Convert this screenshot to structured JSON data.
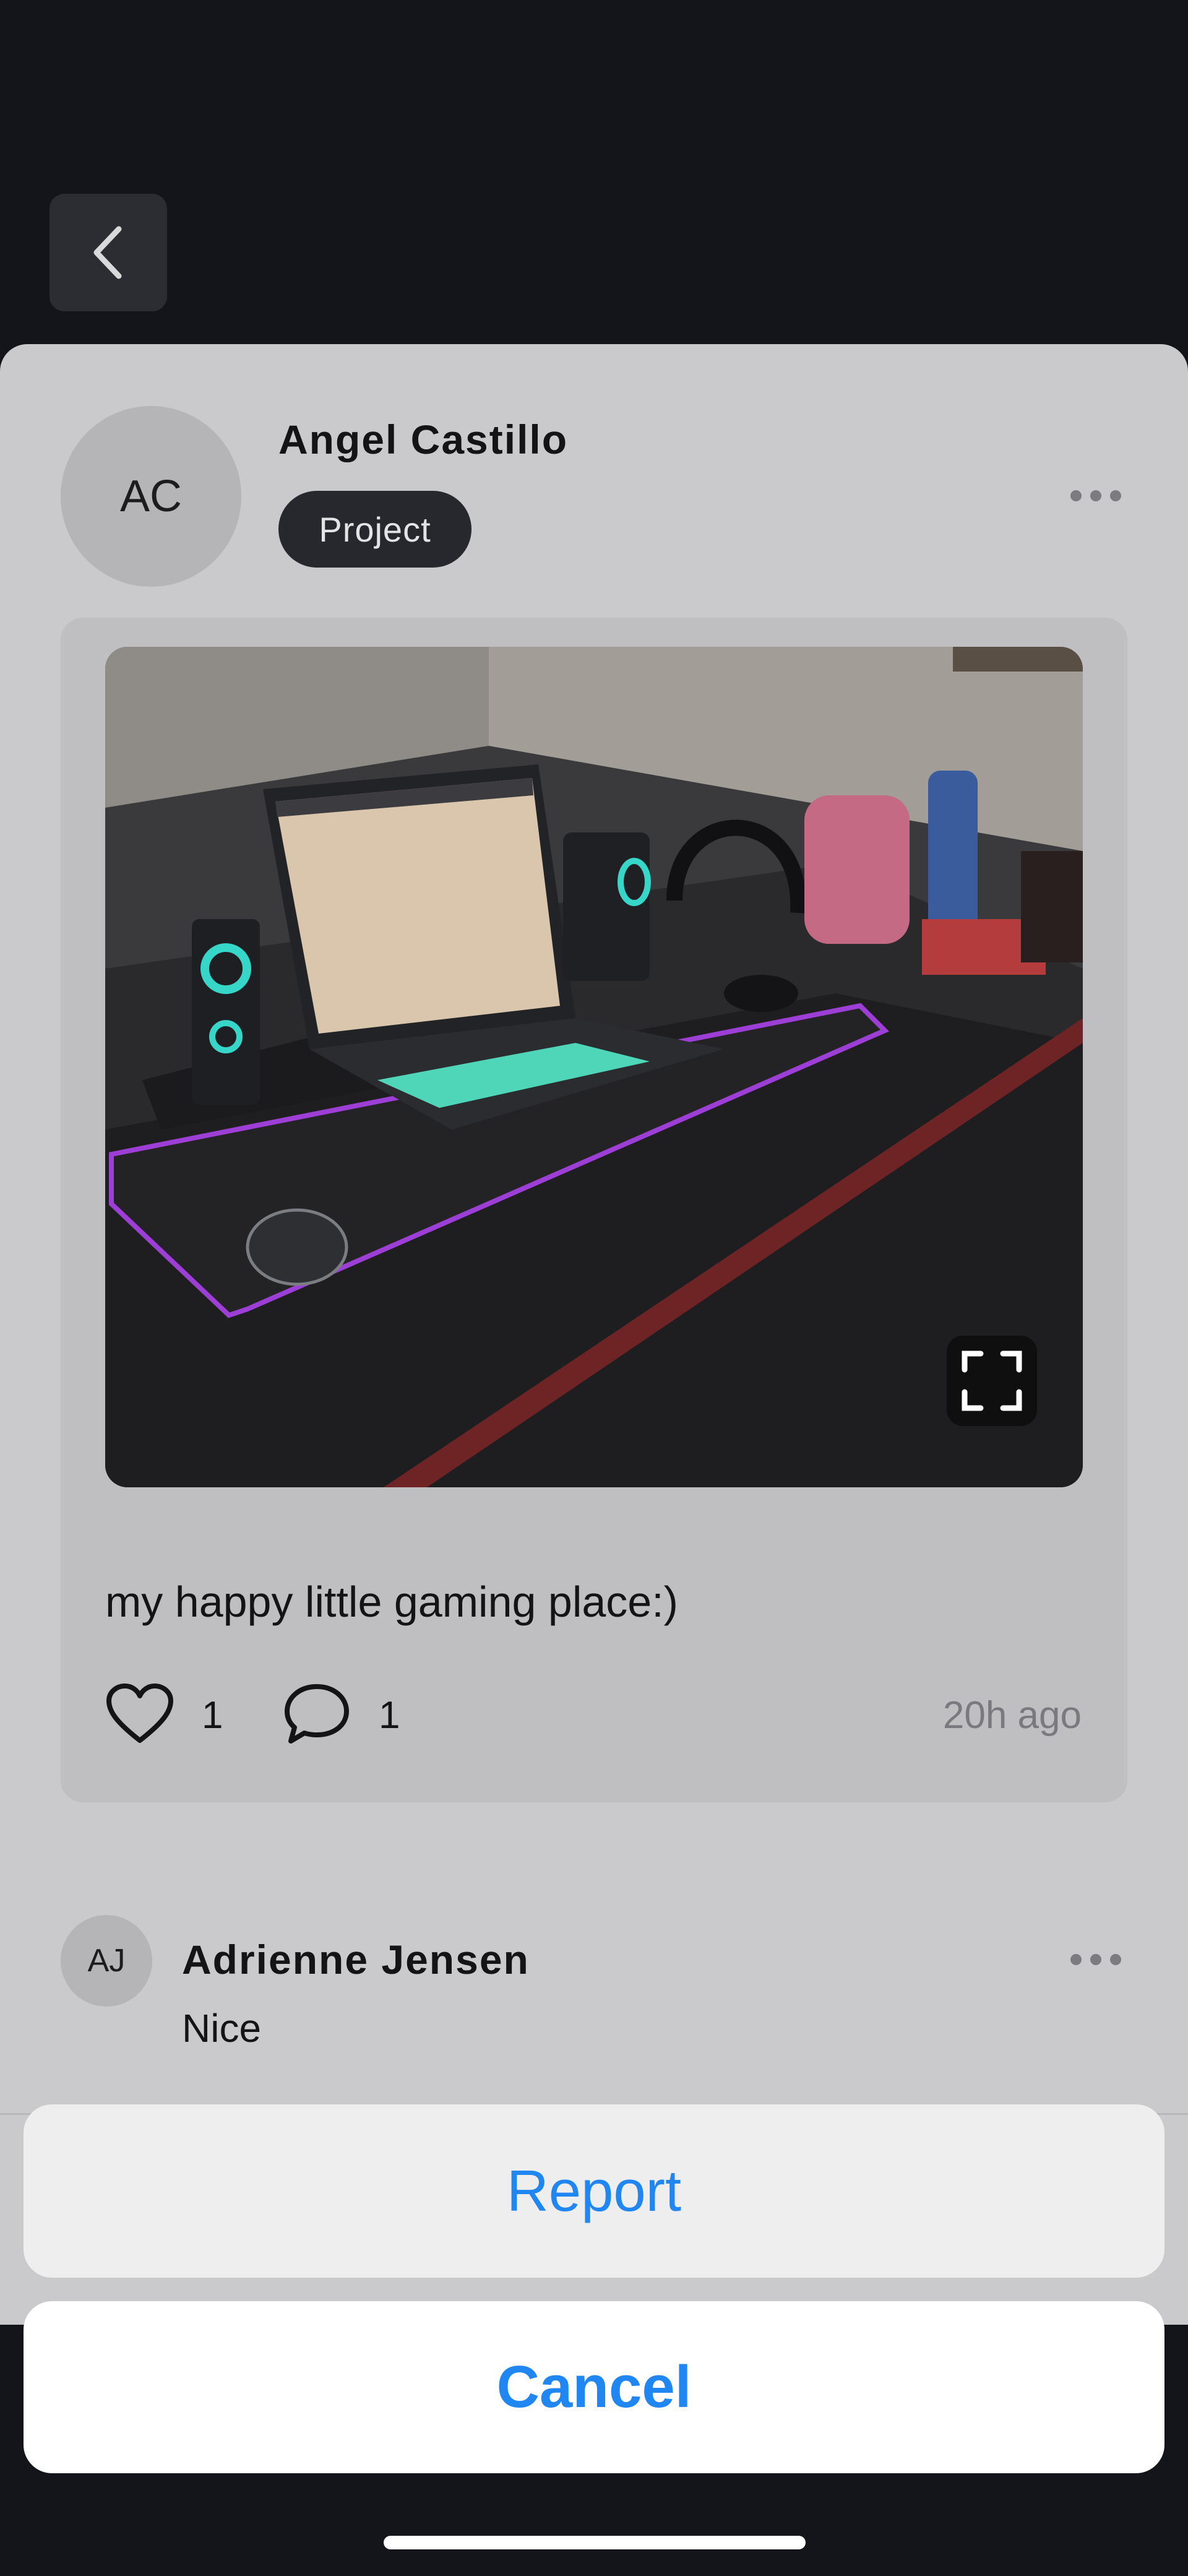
{
  "post": {
    "author_initials": "AC",
    "author_name": "Angel Castillo",
    "badge": "Project",
    "caption": "my happy little gaming place:)",
    "like_count": "1",
    "comment_count": "1",
    "time_ago": "20h ago"
  },
  "comment": {
    "author_initials": "AJ",
    "author_name": "Adrienne Jensen",
    "text": "Nice"
  },
  "action_sheet": {
    "report_label": "Report",
    "cancel_label": "Cancel"
  },
  "colors": {
    "accent": "#1f86f2",
    "background_dark": "#14151b",
    "sheet": "#cacacc",
    "card": "#bfbfc2",
    "badge": "#26282e"
  },
  "icons": [
    "chevron-left-icon",
    "more-icon",
    "expand-icon",
    "heart-icon",
    "comment-icon"
  ]
}
